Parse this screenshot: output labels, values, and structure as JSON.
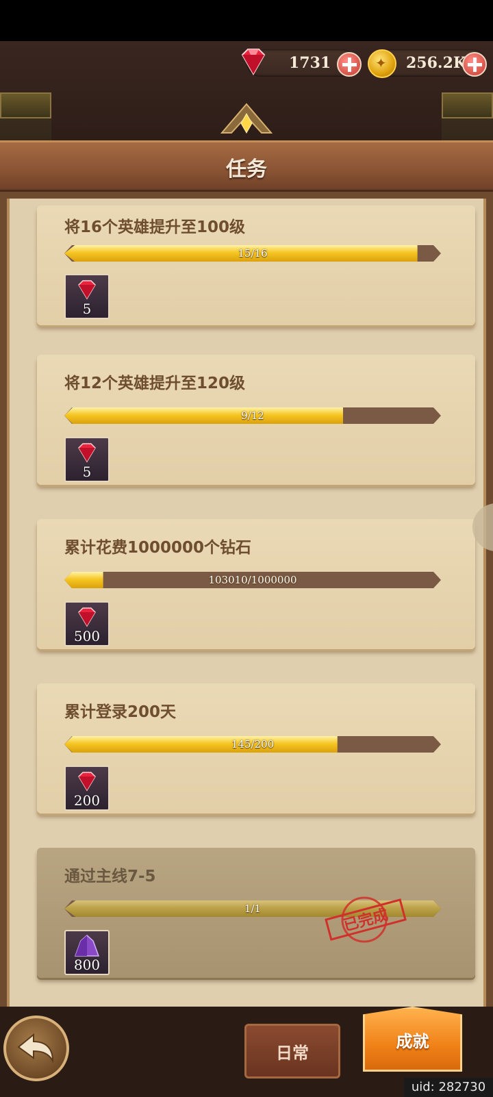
{
  "currencies": {
    "gems": "1731",
    "gold": "256.2K"
  },
  "header": {
    "title": "任务"
  },
  "tasks": [
    {
      "name": "将16个英雄提升至100级",
      "progress_text": "15/16",
      "progress": 0.9375,
      "reward_icon": "ruby-gem-icon",
      "reward_qty": "5",
      "completed": false
    },
    {
      "name": "将12个英雄提升至120级",
      "progress_text": "9/12",
      "progress": 0.75,
      "reward_icon": "ruby-gem-icon",
      "reward_qty": "5",
      "completed": false
    },
    {
      "name": "累计花费1000000个钻石",
      "progress_text": "103010/1000000",
      "progress": 0.103,
      "reward_icon": "ruby-gem-icon",
      "reward_qty": "500",
      "completed": false
    },
    {
      "name": "累计登录200天",
      "progress_text": "145/200",
      "progress": 0.725,
      "reward_icon": "ruby-gem-icon",
      "reward_qty": "200",
      "completed": false
    },
    {
      "name": "通过主线7-5",
      "progress_text": "1/1",
      "progress": 1.0,
      "reward_icon": "purple-crystal-icon",
      "reward_qty": "800",
      "completed": true,
      "stamp_text": "已完成"
    }
  ],
  "tabs": {
    "daily": "日常",
    "achievement": "成就"
  },
  "uid": "uid: 282730",
  "colors": {
    "accent": "#f08218",
    "progress_fill": "#f6c623",
    "stamp": "#d0302a"
  }
}
